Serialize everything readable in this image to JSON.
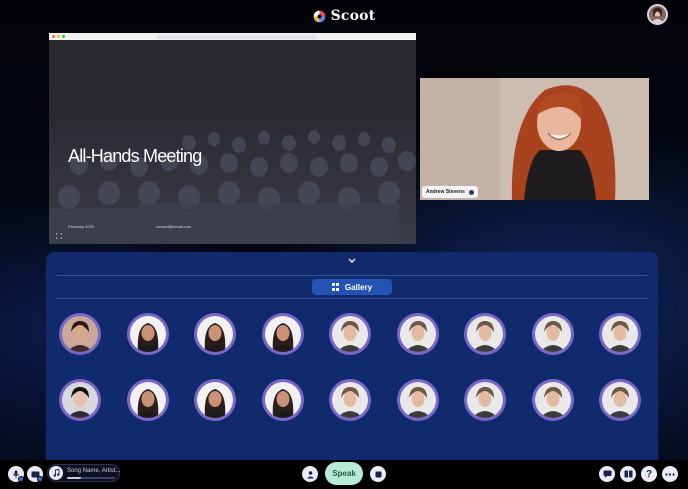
{
  "header": {
    "brand": "Scoot",
    "profile_icon": "user-avatar-icon"
  },
  "slide": {
    "title": "All-Hands Meeting",
    "date": "February 2023",
    "email": "contact@email.com",
    "expand_icon": "expand-icon"
  },
  "speaker": {
    "name": "Andrew Stevens"
  },
  "panel": {
    "collapse_icon": "chevron-down-icon",
    "gallery_label": "Gallery",
    "gallery_icon": "grid-icon"
  },
  "gallery": {
    "rows": [
      [
        "person-a",
        "person-b",
        "person-b",
        "person-b",
        "person-c",
        "person-c",
        "person-c",
        "person-c",
        "person-c"
      ],
      [
        "person-d",
        "person-b",
        "person-b",
        "person-b",
        "person-c",
        "person-c",
        "person-c",
        "person-c",
        "person-c"
      ]
    ]
  },
  "bottombar": {
    "mic_icon": "microphone-icon",
    "camera_icon": "camera-icon",
    "music_icon": "music-note-icon",
    "song_text": "Song Name, Artist...",
    "song_progress": 0.29,
    "invite_icon": "add-user-icon",
    "speak_label": "Speak",
    "stop_icon": "stop-icon",
    "chat_icon": "chat-icon",
    "layout_icon": "layout-icon",
    "help_label": "?",
    "more_icon": "more-icon"
  },
  "colors": {
    "panel": "#102a6d",
    "accent": "#2354b5",
    "tile_ring": "#7b67c8",
    "speak": "#b5ecd6"
  }
}
